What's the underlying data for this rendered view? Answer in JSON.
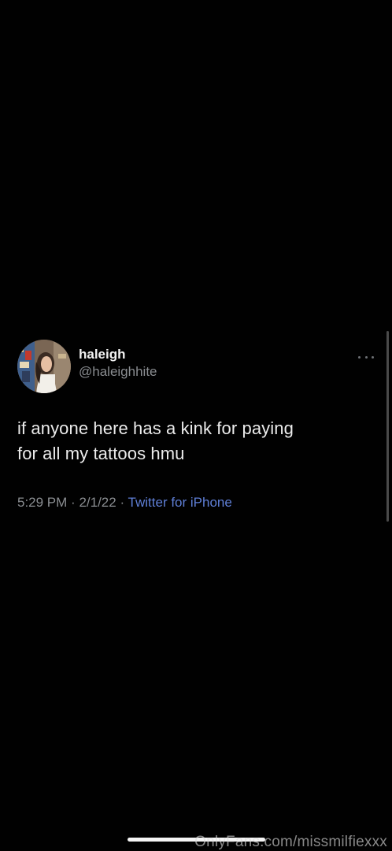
{
  "tweet": {
    "display_name": "haleigh",
    "handle": "@haleighhite",
    "text_line1": "if anyone here has a kink for paying",
    "text_line2": "for all my tattoos hmu",
    "time": "5:29 PM",
    "separator": "·",
    "date": "2/1/22",
    "source": "Twitter for iPhone"
  },
  "icons": {
    "more": "more-horizontal-icon",
    "avatar": "profile-photo"
  },
  "watermark": "OnlyFans.com/missmilfiexxx",
  "colors": {
    "background": "#010101",
    "text_primary": "#ececec",
    "text_secondary": "#8a8d91",
    "link": "#5f7fd6"
  }
}
